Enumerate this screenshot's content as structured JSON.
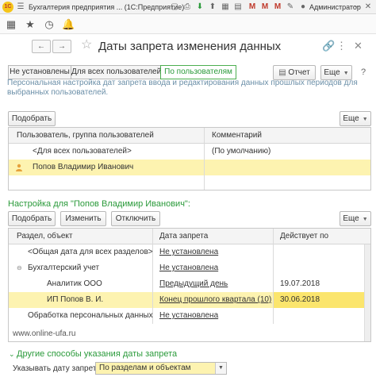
{
  "titlebar": {
    "logo": "1С",
    "app_title": "Бухгалтерия предприятия ... (1С:Предприятие)",
    "user": "Администратор",
    "icons": [
      "copy-icon",
      "save-icon",
      "print-icon",
      "print-preview-icon",
      "upload-icon",
      "calendar-icon",
      "calculator-icon",
      "m-icon",
      "m-plus-icon",
      "m-minus-icon",
      "notes-icon",
      "user-icon",
      "menu-icon",
      "minimize-icon",
      "maximize-icon",
      "close-icon"
    ]
  },
  "toolbar2": {
    "icons": [
      "apps-icon",
      "star-icon",
      "history-icon",
      "bell-icon"
    ]
  },
  "header": {
    "title": "Даты запрета изменения данных",
    "back": "←",
    "forward": "→"
  },
  "filter_tabs": [
    {
      "label": "Не установлены",
      "active": false
    },
    {
      "label": "Для всех пользователей",
      "active": false
    },
    {
      "label": "По пользователям",
      "active": true
    }
  ],
  "report_button": "Отчет",
  "more_label": "Еще",
  "description": "Персональная настройка дат запрета ввода и редактирования данных прошлых периодов для выбранных пользователей.",
  "users_toolbar": {
    "pick_label": "Подобрать",
    "more_label": "Еще"
  },
  "users_table": {
    "columns": [
      "Пользователь, группа пользователей",
      "Комментарий"
    ],
    "rows": [
      {
        "user": "<Для всех пользователей>",
        "comment": "(По умолчанию)"
      },
      {
        "user": "Попов Владимир Иванович",
        "comment": ""
      }
    ]
  },
  "settings": {
    "title": "Настройка для \"Попов Владимир Иванович\":",
    "pick_label": "Подобрать",
    "change_label": "Изменить",
    "disable_label": "Отключить",
    "more_label": "Еще"
  },
  "dates_table": {
    "columns": [
      "Раздел, объект",
      "Дата запрета",
      "Действует по"
    ],
    "rows": [
      {
        "section": "<Общая дата для всех разделов>",
        "date": "Не установлена",
        "valid": ""
      },
      {
        "section": "Бухгалтерский учет",
        "date": "Не установлена",
        "valid": ""
      },
      {
        "section": "Аналитик ООО",
        "date": "Предыдущий день",
        "valid": "19.07.2018"
      },
      {
        "section": "ИП Попов В. И.",
        "date": "Конец прошлого квартала (10)",
        "valid": "30.06.2018"
      },
      {
        "section": "Обработка персональных данных",
        "date": "Не установлена",
        "valid": ""
      }
    ]
  },
  "watermark": "www.online-ufa.ru",
  "other": {
    "title": "Другие способы указания даты запрета",
    "field_label": "Указывать дату запрета:",
    "field_value": "По разделам и объектам"
  },
  "colors": {
    "accent": "#2a9a3a",
    "selection": "#fbe56d",
    "selection_light": "#fdf3b0"
  }
}
